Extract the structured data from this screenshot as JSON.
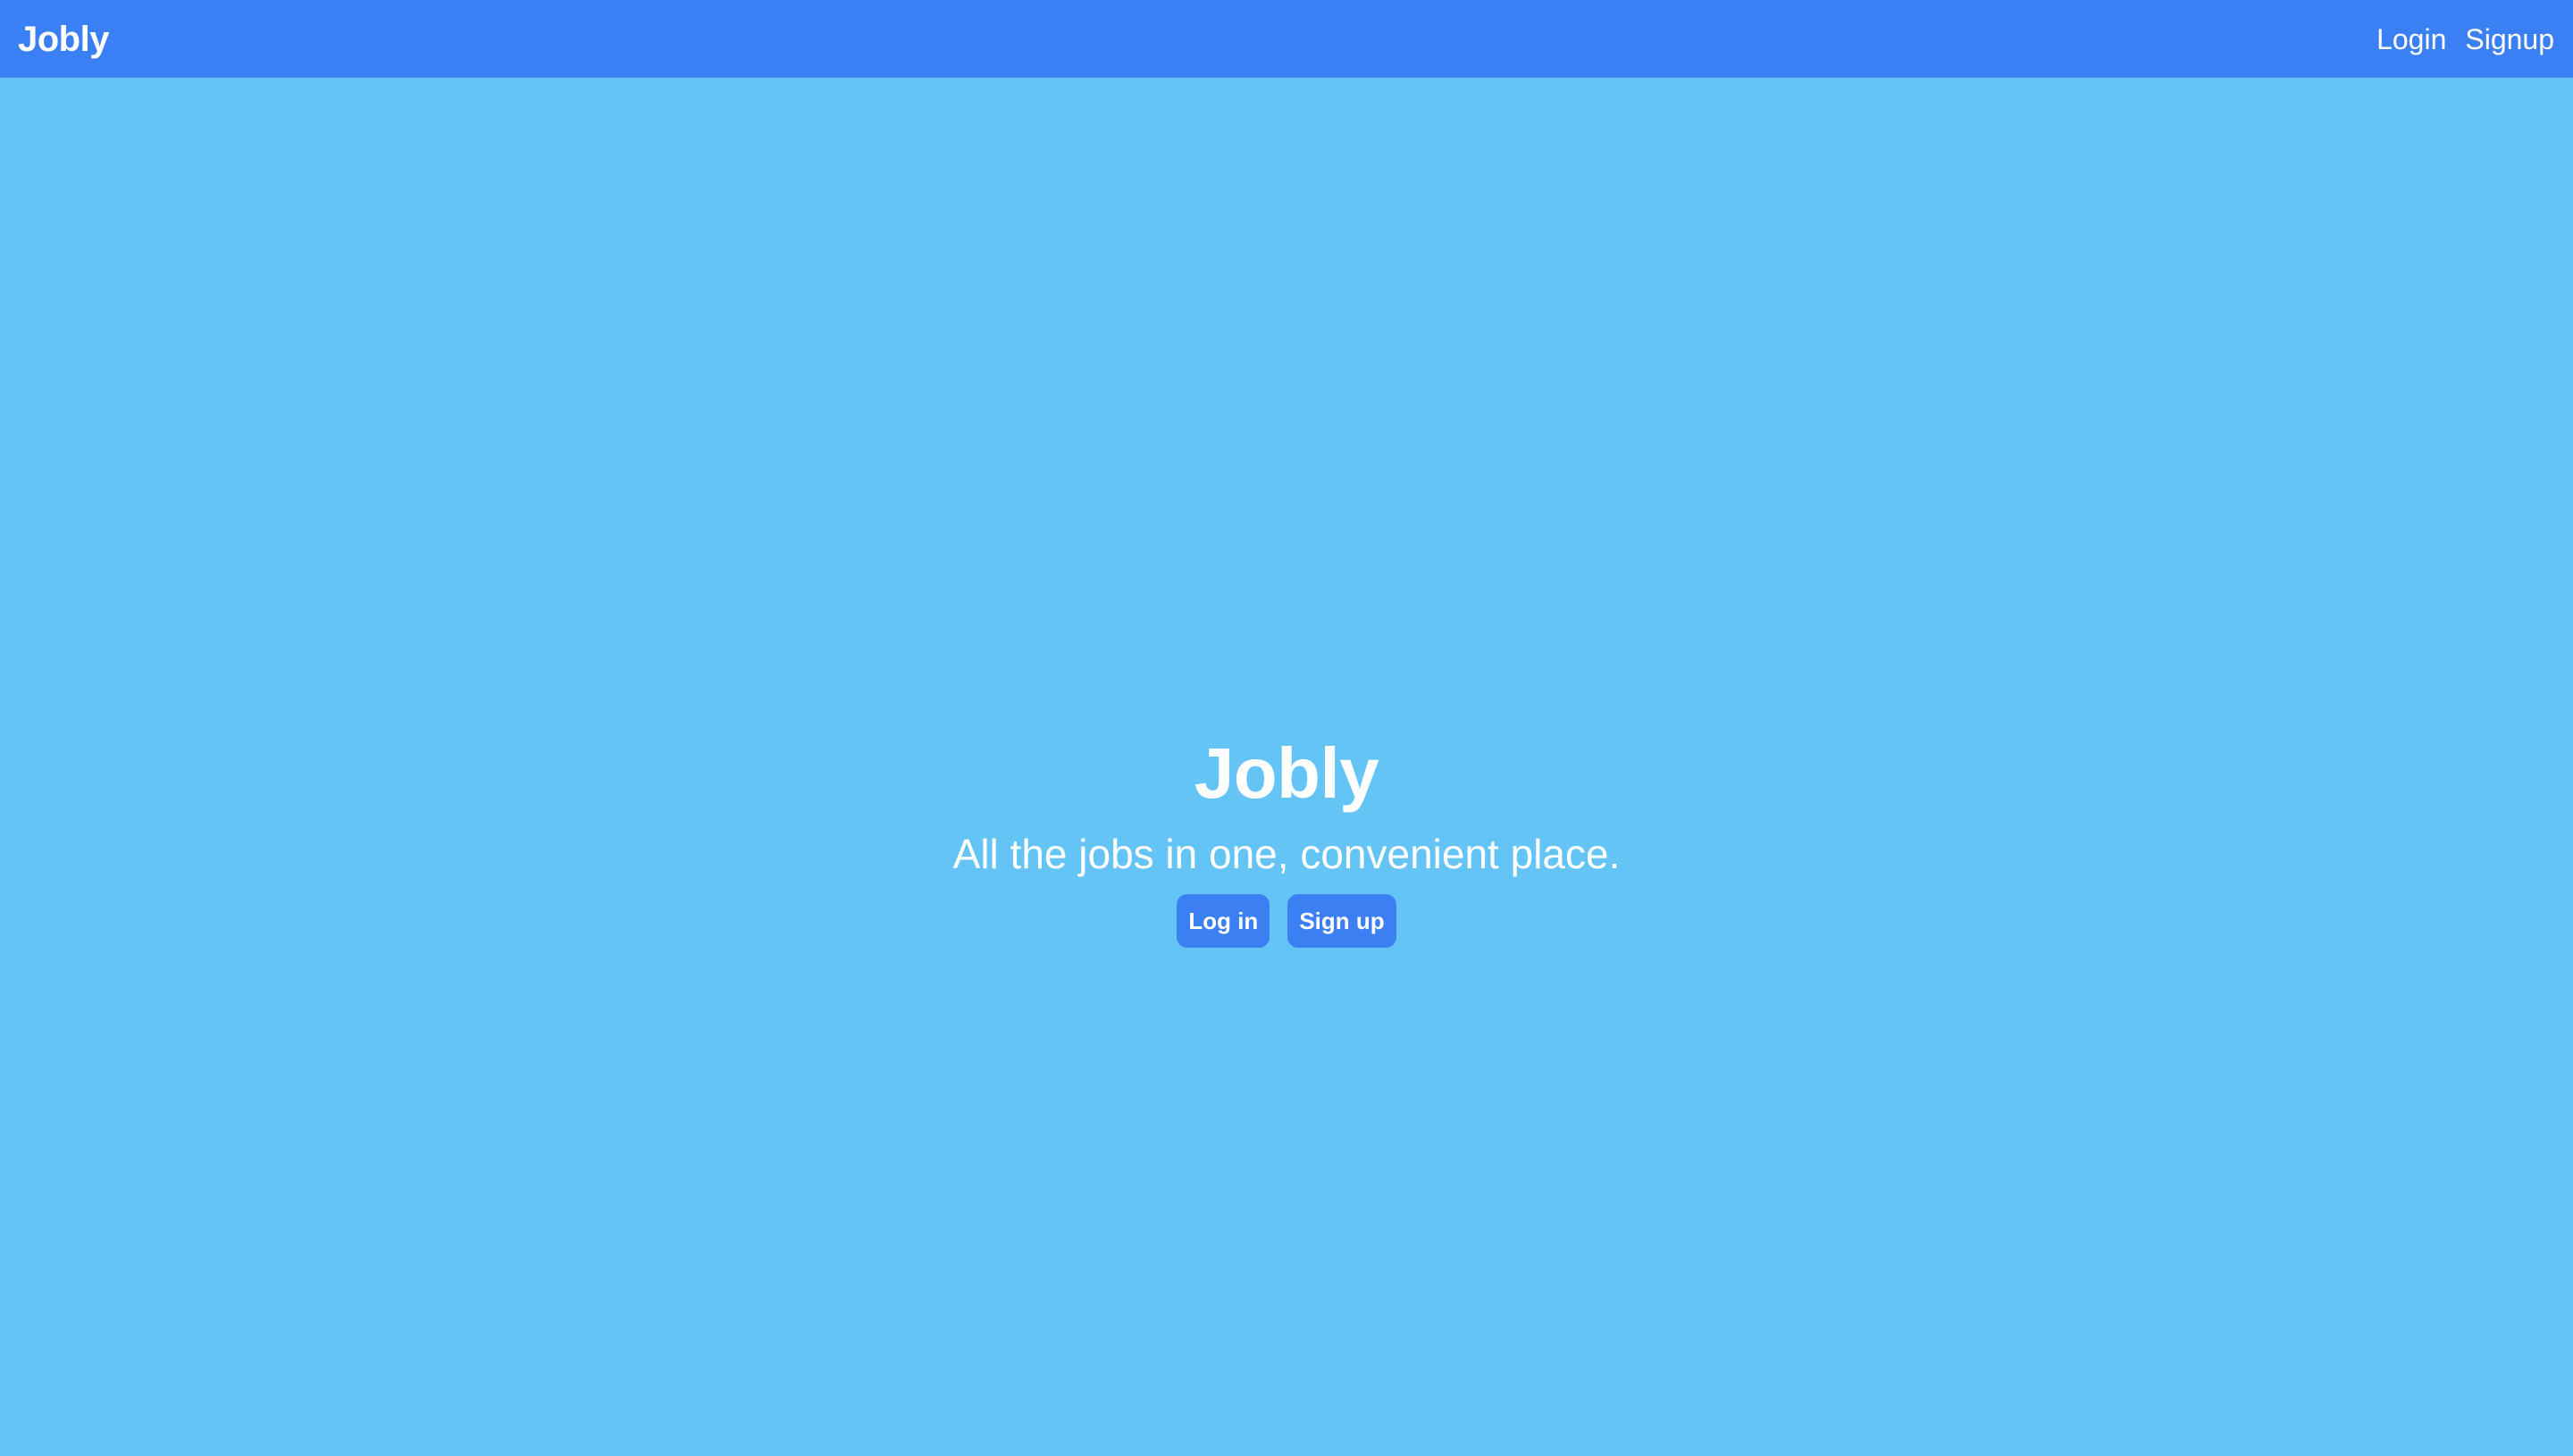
{
  "navbar": {
    "brand": "Jobly",
    "links": [
      {
        "label": "Login"
      },
      {
        "label": "Signup"
      }
    ]
  },
  "hero": {
    "title": "Jobly",
    "tagline": "All the jobs in one, convenient place.",
    "buttons": [
      {
        "label": "Log in"
      },
      {
        "label": "Sign up"
      }
    ]
  },
  "colors": {
    "navbar_bg": "#3a7ff3",
    "page_bg": "#64c4f6",
    "button_bg": "#3b7ff2",
    "text": "#ffffff"
  }
}
